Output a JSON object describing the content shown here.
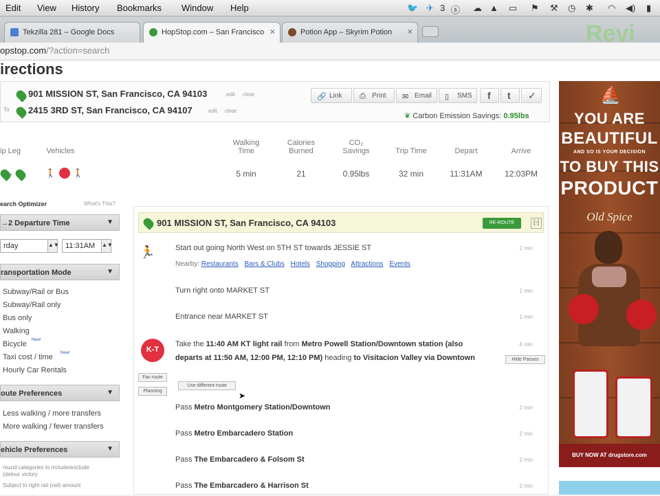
{
  "menubar": {
    "items": [
      "Edit",
      "View",
      "History",
      "Bookmarks",
      "Window",
      "Help"
    ],
    "badge_count": "3"
  },
  "tabs": [
    {
      "label": "Tekzilla 281 – Google Docs",
      "color": "#4a7fd4"
    },
    {
      "label": "HopStop.com – San Francisco",
      "color": "#3a9a3a"
    },
    {
      "label": "Potion App – Skyrim Potion",
      "color": "#7a4a2a"
    }
  ],
  "url": {
    "host": "opstop.com",
    "path": "/?action=search"
  },
  "watermark": "Revi",
  "page": {
    "title": "irections",
    "from_label": "",
    "to_label": "To",
    "from_address": "901 MISSION ST, San Francisco, CA 94103",
    "to_address": "2415 3RD ST, San Francisco, CA 94107",
    "addr_tools": [
      "edit",
      "clear"
    ],
    "share_buttons": [
      {
        "label": "Link",
        "icon": "link-icon"
      },
      {
        "label": "Print",
        "icon": "print-icon"
      },
      {
        "label": "Email",
        "icon": "email-icon"
      },
      {
        "label": "SMS",
        "icon": "sms-icon"
      }
    ],
    "co2_label": "Carbon Emission Savings:",
    "co2_value": "0.95lbs"
  },
  "summary": {
    "headers": [
      "ip Leg",
      "Vehicles",
      "Walking Time",
      "Calories Burned",
      "CO₂ Savings",
      "Trip Time",
      "Depart",
      "Arrive"
    ],
    "values": [
      "5 min",
      "21",
      "0.95lbs",
      "32 min",
      "11:31AM",
      "12:03PM"
    ]
  },
  "sidebar": {
    "title": "earch Optimizer",
    "whats_this": "What's This?",
    "section1": "→2 Departure Time",
    "day": "rday",
    "time": "11:31AM",
    "section2": "ransportation Mode",
    "modes": [
      "Subway/Rail or Bus",
      "Subway/Rail only",
      "Bus only",
      "Walking",
      "Bicycle",
      "Taxi cost / time",
      "Hourly Car Rentals"
    ],
    "new_tag": "New!",
    "section3": "oute Preferences",
    "prefs": [
      "Less walking / more transfers",
      "More walking / fewer transfers"
    ],
    "section4": "ehicle Preferences",
    "note1": "round categories to include/exclude",
    "note2": "(detour victory",
    "note3": "Subject to right rail (rail) amount"
  },
  "directions": {
    "start_address": "901 MISSION ST, San Francisco, CA 94103",
    "reroute_label": "RE-ROUTE",
    "collapse_label": "[-]",
    "step1": "Start out going North West on 5TH ST towards JESSIE ST",
    "nearby_label": "Nearby:",
    "nearby_links": [
      "Restaurants",
      "Bars & Clubs",
      "Hotels",
      "Shopping",
      "Attractions",
      "Events"
    ],
    "step2": "Turn right onto MARKET ST",
    "step3": "Entrance near MARKET ST",
    "step4_pre": "Take the ",
    "step4_b1": "11:40 AM KT light rail",
    "step4_mid": " from ",
    "step4_b2": "Metro Powell Station/Downtown station (also departs at 11:50 AM, 12:00 PM, 12:10 PM)",
    "step4_heading": " heading ",
    "step4_to": "to",
    "step4_b3": "Visitacion Valley via Downtown",
    "kt_badge": "K-T",
    "use_different": "Use different route",
    "hide_passes": "Hide Passes",
    "fav_label": "Fav route",
    "sched_label": "Planning",
    "pass_label": "Pass",
    "passes": [
      "Metro Montgomery Station/Downtown",
      "Metro Embarcadero Station",
      "The Embarcadero & Folsom St",
      "The Embarcadero & Harrison St"
    ],
    "durs": [
      "2 min",
      "1 min",
      "1 min",
      "4 min",
      "2 min",
      "2 min",
      "2 min",
      "2 min"
    ]
  },
  "ad": {
    "line1": "YOU ARE",
    "line2": "BEAUTIFUL",
    "line3": "AND SO IS YOUR DECISION",
    "line4": "TO BUY THIS",
    "line5": "PRODUCT",
    "brand": "Old Spice",
    "footer": "BUY NOW AT drugstore.com"
  }
}
